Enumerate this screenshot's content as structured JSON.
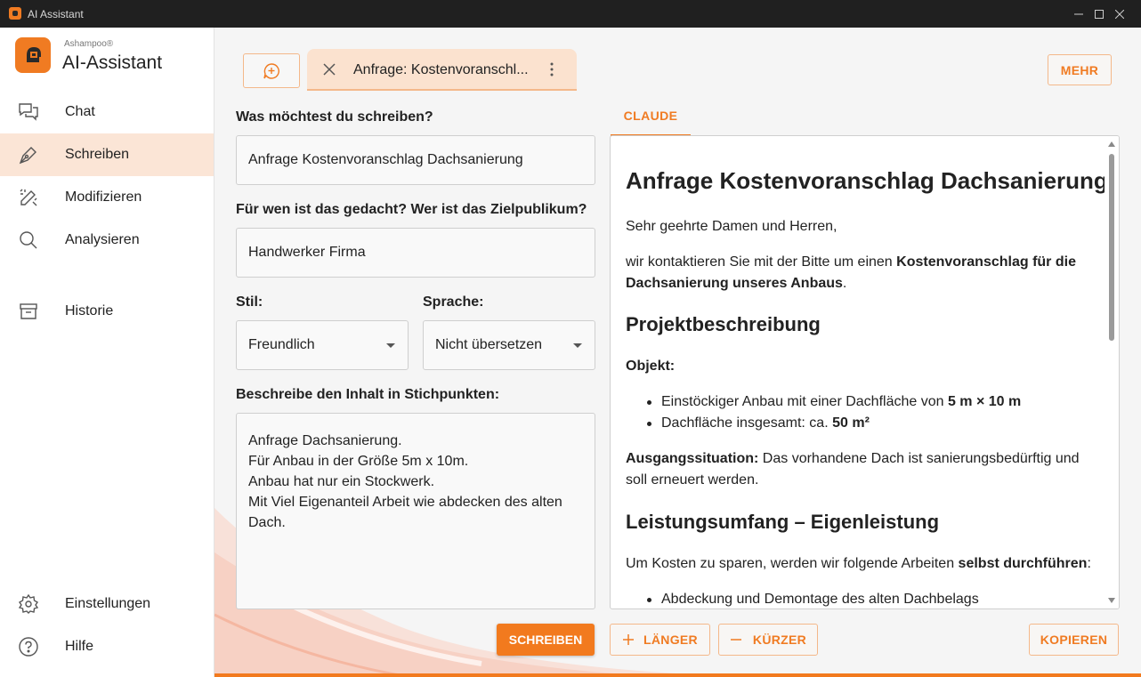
{
  "window": {
    "title": "AI Assistant"
  },
  "brand": {
    "small": "Ashampoo®",
    "name": "AI-Assistant"
  },
  "sidebar": {
    "items": [
      {
        "label": "Chat",
        "icon": "chat-bubbles-icon"
      },
      {
        "label": "Schreiben",
        "icon": "pen-nib-icon",
        "active": true
      },
      {
        "label": "Modifizieren",
        "icon": "magic-pencil-icon"
      },
      {
        "label": "Analysieren",
        "icon": "magnifier-icon"
      },
      {
        "label": "Historie",
        "icon": "archive-box-icon"
      }
    ],
    "footer": [
      {
        "label": "Einstellungen",
        "icon": "gear-icon"
      },
      {
        "label": "Hilfe",
        "icon": "help-circle-icon"
      }
    ]
  },
  "tabs": {
    "active_label": "Anfrage: Kostenvoranschl...",
    "more_label": "MEHR"
  },
  "form": {
    "topic_label": "Was möchtest du schreiben?",
    "topic_value": "Anfrage Kostenvoranschlag Dachsanierung",
    "audience_label": "Für wen ist das gedacht? Wer ist das Zielpublikum?",
    "audience_value": "Handwerker Firma",
    "style_label": "Stil:",
    "style_value": "Freundlich",
    "language_label": "Sprache:",
    "language_value": "Nicht übersetzen",
    "content_label": "Beschreibe den Inhalt in Stichpunkten:",
    "content_lines": [
      "Anfrage Dachsanierung.",
      "Für Anbau in der Größe 5m x 10m.",
      "Anbau hat nur ein Stockwerk.",
      "Mit Viel Eigenanteil Arbeit wie abdecken des alten",
      "Dach."
    ]
  },
  "output": {
    "tab_label": "CLAUDE",
    "title": "Anfrage Kostenvoranschlag Dachsanierung",
    "greeting": "Sehr geehrte Damen und Herren,",
    "intro_prefix": "wir kontaktieren Sie mit der Bitte um einen ",
    "intro_bold": "Kostenvoranschlag für die Dachsanierung unseres Anbaus",
    "intro_suffix": ".",
    "h_project": "Projektbeschreibung",
    "object_label": "Objekt:",
    "bullet1_prefix": "Einstöckiger Anbau mit einer Dachfläche von ",
    "bullet1_bold": "5 m × 10 m",
    "bullet2_prefix": "Dachfläche insgesamt: ca. ",
    "bullet2_bold": "50 m²",
    "situation_label": "Ausgangssituation:",
    "situation_text": " Das vorhandene Dach ist sanierungsbedürftig und soll erneuert werden.",
    "h_scope": "Leistungsumfang – Eigenleistung",
    "scope_prefix": "Um Kosten zu sparen, werden wir folgende Arbeiten ",
    "scope_bold": "selbst durchführen",
    "scope_suffix": ":",
    "bullet3": "Abdeckung und Demontage des alten Dachbelags"
  },
  "actions": {
    "write": "SCHREIBEN",
    "longer": "LÄNGER",
    "shorter": "KÜRZER",
    "copy": "KOPIEREN"
  },
  "colors": {
    "accent": "#f27a1e",
    "accent_light": "#fbe5d6",
    "border_accent": "#f4b88a"
  }
}
